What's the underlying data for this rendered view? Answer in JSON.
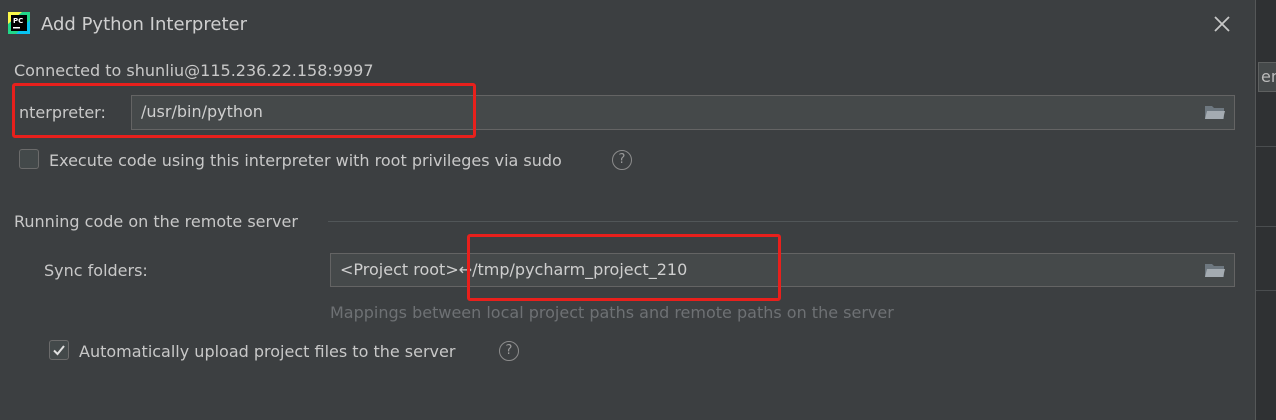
{
  "window": {
    "title": "Add Python Interpreter",
    "icon": "pycharm-logo-icon",
    "icon_text": "PC"
  },
  "background": {
    "partial_text": "env"
  },
  "connection": {
    "text": "Connected to shunliu@115.236.22.158:9997"
  },
  "interpreter": {
    "label": "nterpreter:",
    "value": "/usr/bin/python"
  },
  "sudo": {
    "label": "Execute code using this interpreter with root privileges via sudo",
    "checked": false
  },
  "remote_section": {
    "title": "Running code on the remote server",
    "sync_label": "Sync folders:",
    "sync_value": "<Project root>↔/tmp/pycharm_project_210",
    "hint": "Mappings between local project paths and remote paths on the server",
    "auto_upload_label": "Automatically upload project files to the server",
    "auto_upload_checked": true
  },
  "help_glyph": "?",
  "colors": {
    "background": "#3c3f41",
    "field": "#45494a",
    "annotation_red": "#e8201c"
  }
}
